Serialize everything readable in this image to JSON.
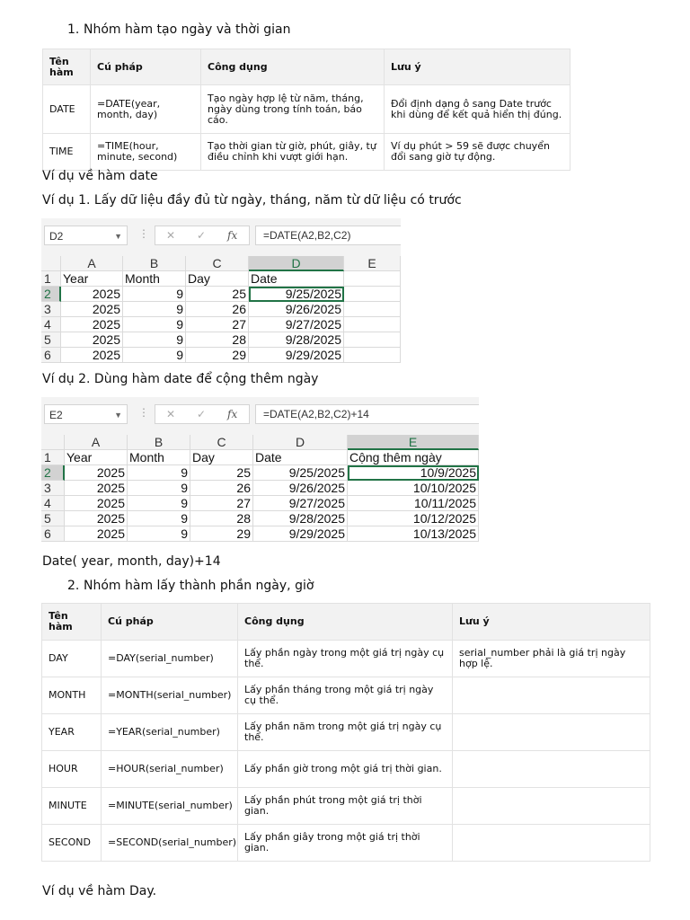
{
  "heading1": {
    "number": "1.",
    "text": "Nhóm hàm tạo ngày và thời gian"
  },
  "table1": {
    "headers": [
      "Tên hàm",
      "Cú pháp",
      "Công dụng",
      "Lưu ý"
    ],
    "rows": [
      [
        "DATE",
        "=DATE(year, month, day)",
        "Tạo ngày hợp lệ từ năm, tháng, ngày dùng trong tính toán, báo cáo.",
        "Đổi định dạng ô sang Date trước khi dùng để kết quả hiển thị đúng."
      ],
      [
        "TIME",
        "=TIME(hour, minute, second)",
        "Tạo thời gian từ giờ, phút, giây, tự điều chỉnh khi vượt giới hạn.",
        "Ví dụ phút > 59 sẽ được chuyển đổi sang giờ tự động."
      ]
    ]
  },
  "para_date_example": "Ví dụ về hàm date",
  "example1_title": "Ví dụ 1. Lấy dữ liệu đầy đủ từ ngày, tháng, năm từ dữ liệu có trước",
  "sheet1": {
    "name_box": "D2",
    "formula": "=DATE(A2,B2,C2)",
    "fx": "fx",
    "columns": [
      "A",
      "B",
      "C",
      "D",
      "E"
    ],
    "selected_col": 3,
    "rows": [
      [
        "Year",
        "Month",
        "Day",
        "Date",
        ""
      ],
      [
        "2025",
        "9",
        "25",
        "9/25/2025",
        ""
      ],
      [
        "2025",
        "9",
        "26",
        "9/26/2025",
        ""
      ],
      [
        "2025",
        "9",
        "27",
        "9/27/2025",
        ""
      ],
      [
        "2025",
        "9",
        "28",
        "9/28/2025",
        ""
      ],
      [
        "2025",
        "9",
        "29",
        "9/29/2025",
        ""
      ]
    ]
  },
  "example2_title": "Ví dụ 2. Dùng hàm date để cộng thêm ngày",
  "sheet2": {
    "name_box": "E2",
    "formula": "=DATE(A2,B2,C2)+14",
    "fx": "fx",
    "columns": [
      "A",
      "B",
      "C",
      "D",
      "E"
    ],
    "selected_col": 4,
    "rows": [
      [
        "Year",
        "Month",
        "Day",
        "Date",
        "Cộng thêm ngày"
      ],
      [
        "2025",
        "9",
        "25",
        "9/25/2025",
        "10/9/2025"
      ],
      [
        "2025",
        "9",
        "26",
        "9/26/2025",
        "10/10/2025"
      ],
      [
        "2025",
        "9",
        "27",
        "9/27/2025",
        "10/11/2025"
      ],
      [
        "2025",
        "9",
        "28",
        "9/28/2025",
        "10/12/2025"
      ],
      [
        "2025",
        "9",
        "29",
        "9/29/2025",
        "10/13/2025"
      ]
    ]
  },
  "formula_note": "Date( year, month, day)+14",
  "heading2": {
    "number": "2.",
    "text": "Nhóm hàm lấy thành phần ngày, giờ"
  },
  "table2": {
    "headers": [
      "Tên hàm",
      "Cú pháp",
      "Công dụng",
      "Lưu ý"
    ],
    "rows": [
      [
        "DAY",
        "=DAY(serial_number)",
        "Lấy phần ngày trong một giá trị ngày cụ thể.",
        "serial_number phải là giá trị ngày hợp lệ."
      ],
      [
        "MONTH",
        "=MONTH(serial_number)",
        "Lấy phần tháng trong một giá trị ngày cụ thể.",
        ""
      ],
      [
        "YEAR",
        "=YEAR(serial_number)",
        "Lấy phần năm trong một giá trị ngày cụ thể.",
        ""
      ],
      [
        "HOUR",
        "=HOUR(serial_number)",
        "Lấy phần giờ trong một giá trị thời gian.",
        ""
      ],
      [
        "MINUTE",
        "=MINUTE(serial_number)",
        "Lấy phần phút trong một giá trị thời gian.",
        ""
      ],
      [
        "SECOND",
        "=SECOND(serial_number)",
        "Lấy phần giây trong một giá trị thời gian.",
        ""
      ]
    ]
  },
  "para_day_example": "Ví dụ về hàm Day."
}
